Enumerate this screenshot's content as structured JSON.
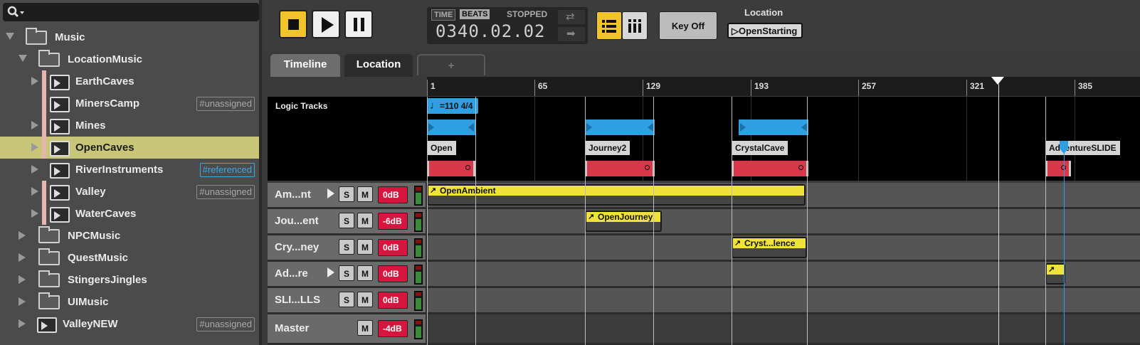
{
  "browser": {
    "search_icon": "search-icon",
    "items": [
      {
        "label": "Music",
        "tag": ""
      },
      {
        "label": "LocationMusic",
        "tag": ""
      },
      {
        "label": "EarthCaves",
        "tag": ""
      },
      {
        "label": "MinersCamp",
        "tag": "#unassigned"
      },
      {
        "label": "Mines",
        "tag": ""
      },
      {
        "label": "OpenCaves",
        "tag": ""
      },
      {
        "label": "RiverInstruments",
        "tag": "#referenced"
      },
      {
        "label": "Valley",
        "tag": "#unassigned"
      },
      {
        "label": "WaterCaves",
        "tag": ""
      },
      {
        "label": "NPCMusic",
        "tag": ""
      },
      {
        "label": "QuestMusic",
        "tag": ""
      },
      {
        "label": "StingersJingles",
        "tag": ""
      },
      {
        "label": "UIMusic",
        "tag": ""
      },
      {
        "label": "ValleyNEW",
        "tag": "#unassigned"
      }
    ]
  },
  "transport": {
    "time_tab": "TIME",
    "beats_tab": "BEATS",
    "status": "STOPPED",
    "position": "0340.02.02",
    "key_off": "Key Off",
    "param_label": "Location",
    "param_value": "OpenStarting"
  },
  "tabs": {
    "timeline": "Timeline",
    "location": "Location",
    "add": "+"
  },
  "ruler": {
    "ticks": [
      "1",
      "65",
      "129",
      "193",
      "257",
      "321",
      "385"
    ]
  },
  "logic": {
    "title": "Logic Tracks",
    "tempo": "=110 4/4",
    "markers": [
      "Open",
      "Journey2",
      "CrystalCave",
      "AdventureSLIDE"
    ]
  },
  "tracks": [
    {
      "name": "Am...nt",
      "solo": "S",
      "mute": "M",
      "vol": "0dB",
      "clip": "OpenAmbient"
    },
    {
      "name": "Jou...ent",
      "solo": "S",
      "mute": "M",
      "vol": "-6dB",
      "clip": "OpenJourney"
    },
    {
      "name": "Cry...ney",
      "solo": "S",
      "mute": "M",
      "vol": "0dB",
      "clip": "Cryst...lence"
    },
    {
      "name": "Ad...re",
      "solo": "S",
      "mute": "M",
      "vol": "0dB",
      "clip": ""
    },
    {
      "name": "SLI...LLS",
      "solo": "S",
      "mute": "M",
      "vol": "0dB",
      "clip": ""
    },
    {
      "name": "Master",
      "solo": "",
      "mute": "M",
      "vol": "-4dB",
      "clip": ""
    }
  ],
  "colors": {
    "accent": "#f2c42c",
    "region": "#2e9fe0",
    "clip": "#efe23a",
    "transition": "#d9374a",
    "volume": "#d6163f",
    "selection": "#c9c67a"
  }
}
